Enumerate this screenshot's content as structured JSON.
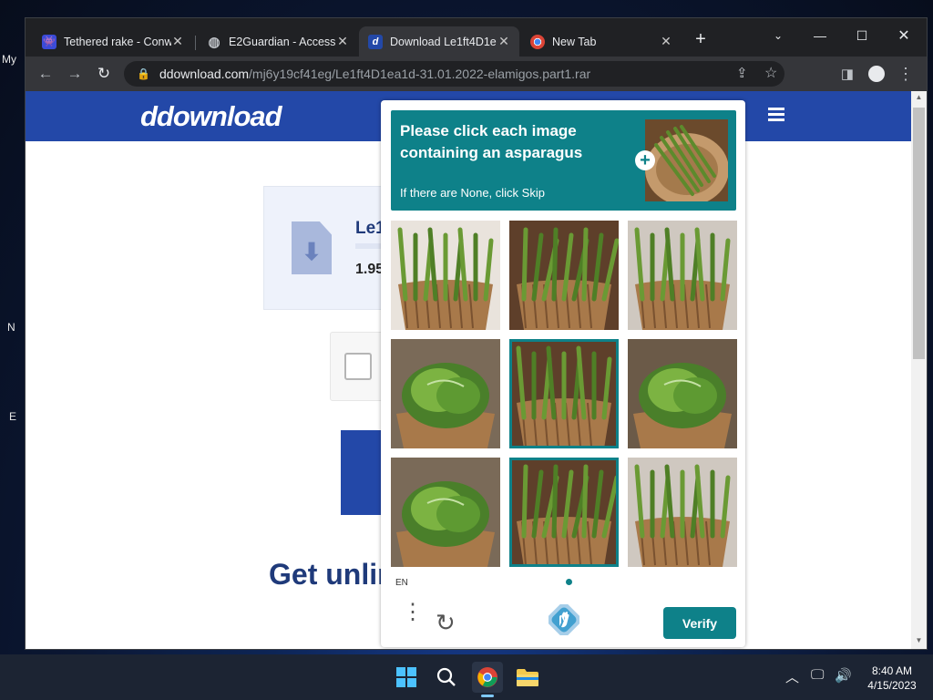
{
  "desktop": {
    "icons": [
      {
        "label": "My"
      },
      {
        "label": "N"
      },
      {
        "label": "E"
      }
    ]
  },
  "browser": {
    "tabs": [
      {
        "title": "Tethered rake - Conw",
        "icon": "game-icon",
        "active": false
      },
      {
        "title": "E2Guardian - Access",
        "icon": "globe-icon",
        "active": false
      },
      {
        "title": "Download Le1ft4D1e",
        "icon": "d-logo-icon",
        "active": true
      },
      {
        "title": "New Tab",
        "icon": "chrome-icon",
        "active": false
      }
    ],
    "new_tab_label": "+",
    "address": {
      "host": "ddownload.com",
      "path": "/mj6y19cf41eg/Le1ft4D1ea1d-31.01.2022-elamigos.part1.rar"
    }
  },
  "page": {
    "logo": "ddownload",
    "file_name": "Le1",
    "file_size": "1.95",
    "promo_text": "Get unlir"
  },
  "captcha": {
    "prompt": "Please click each image containing an asparagus",
    "skip_hint": "If there are None, click Skip",
    "language": "EN",
    "verify_label": "Verify",
    "accent": "#0e8189",
    "tiles": [
      {
        "subject": "asparagus in basket",
        "selected": false
      },
      {
        "subject": "asparagus in basket",
        "selected": false
      },
      {
        "subject": "asparagus in basket",
        "selected": false
      },
      {
        "subject": "cabbage in basket",
        "selected": false
      },
      {
        "subject": "asparagus in basket",
        "selected": true
      },
      {
        "subject": "cabbage in basket",
        "selected": false
      },
      {
        "subject": "cabbage in basket",
        "selected": false
      },
      {
        "subject": "asparagus in basket",
        "selected": true
      },
      {
        "subject": "asparagus in basket",
        "selected": false
      }
    ]
  },
  "taskbar": {
    "time": "8:40 AM",
    "date": "4/15/2023",
    "icons": [
      "windows-start-icon",
      "search-icon",
      "chrome-icon",
      "file-explorer-icon"
    ]
  }
}
